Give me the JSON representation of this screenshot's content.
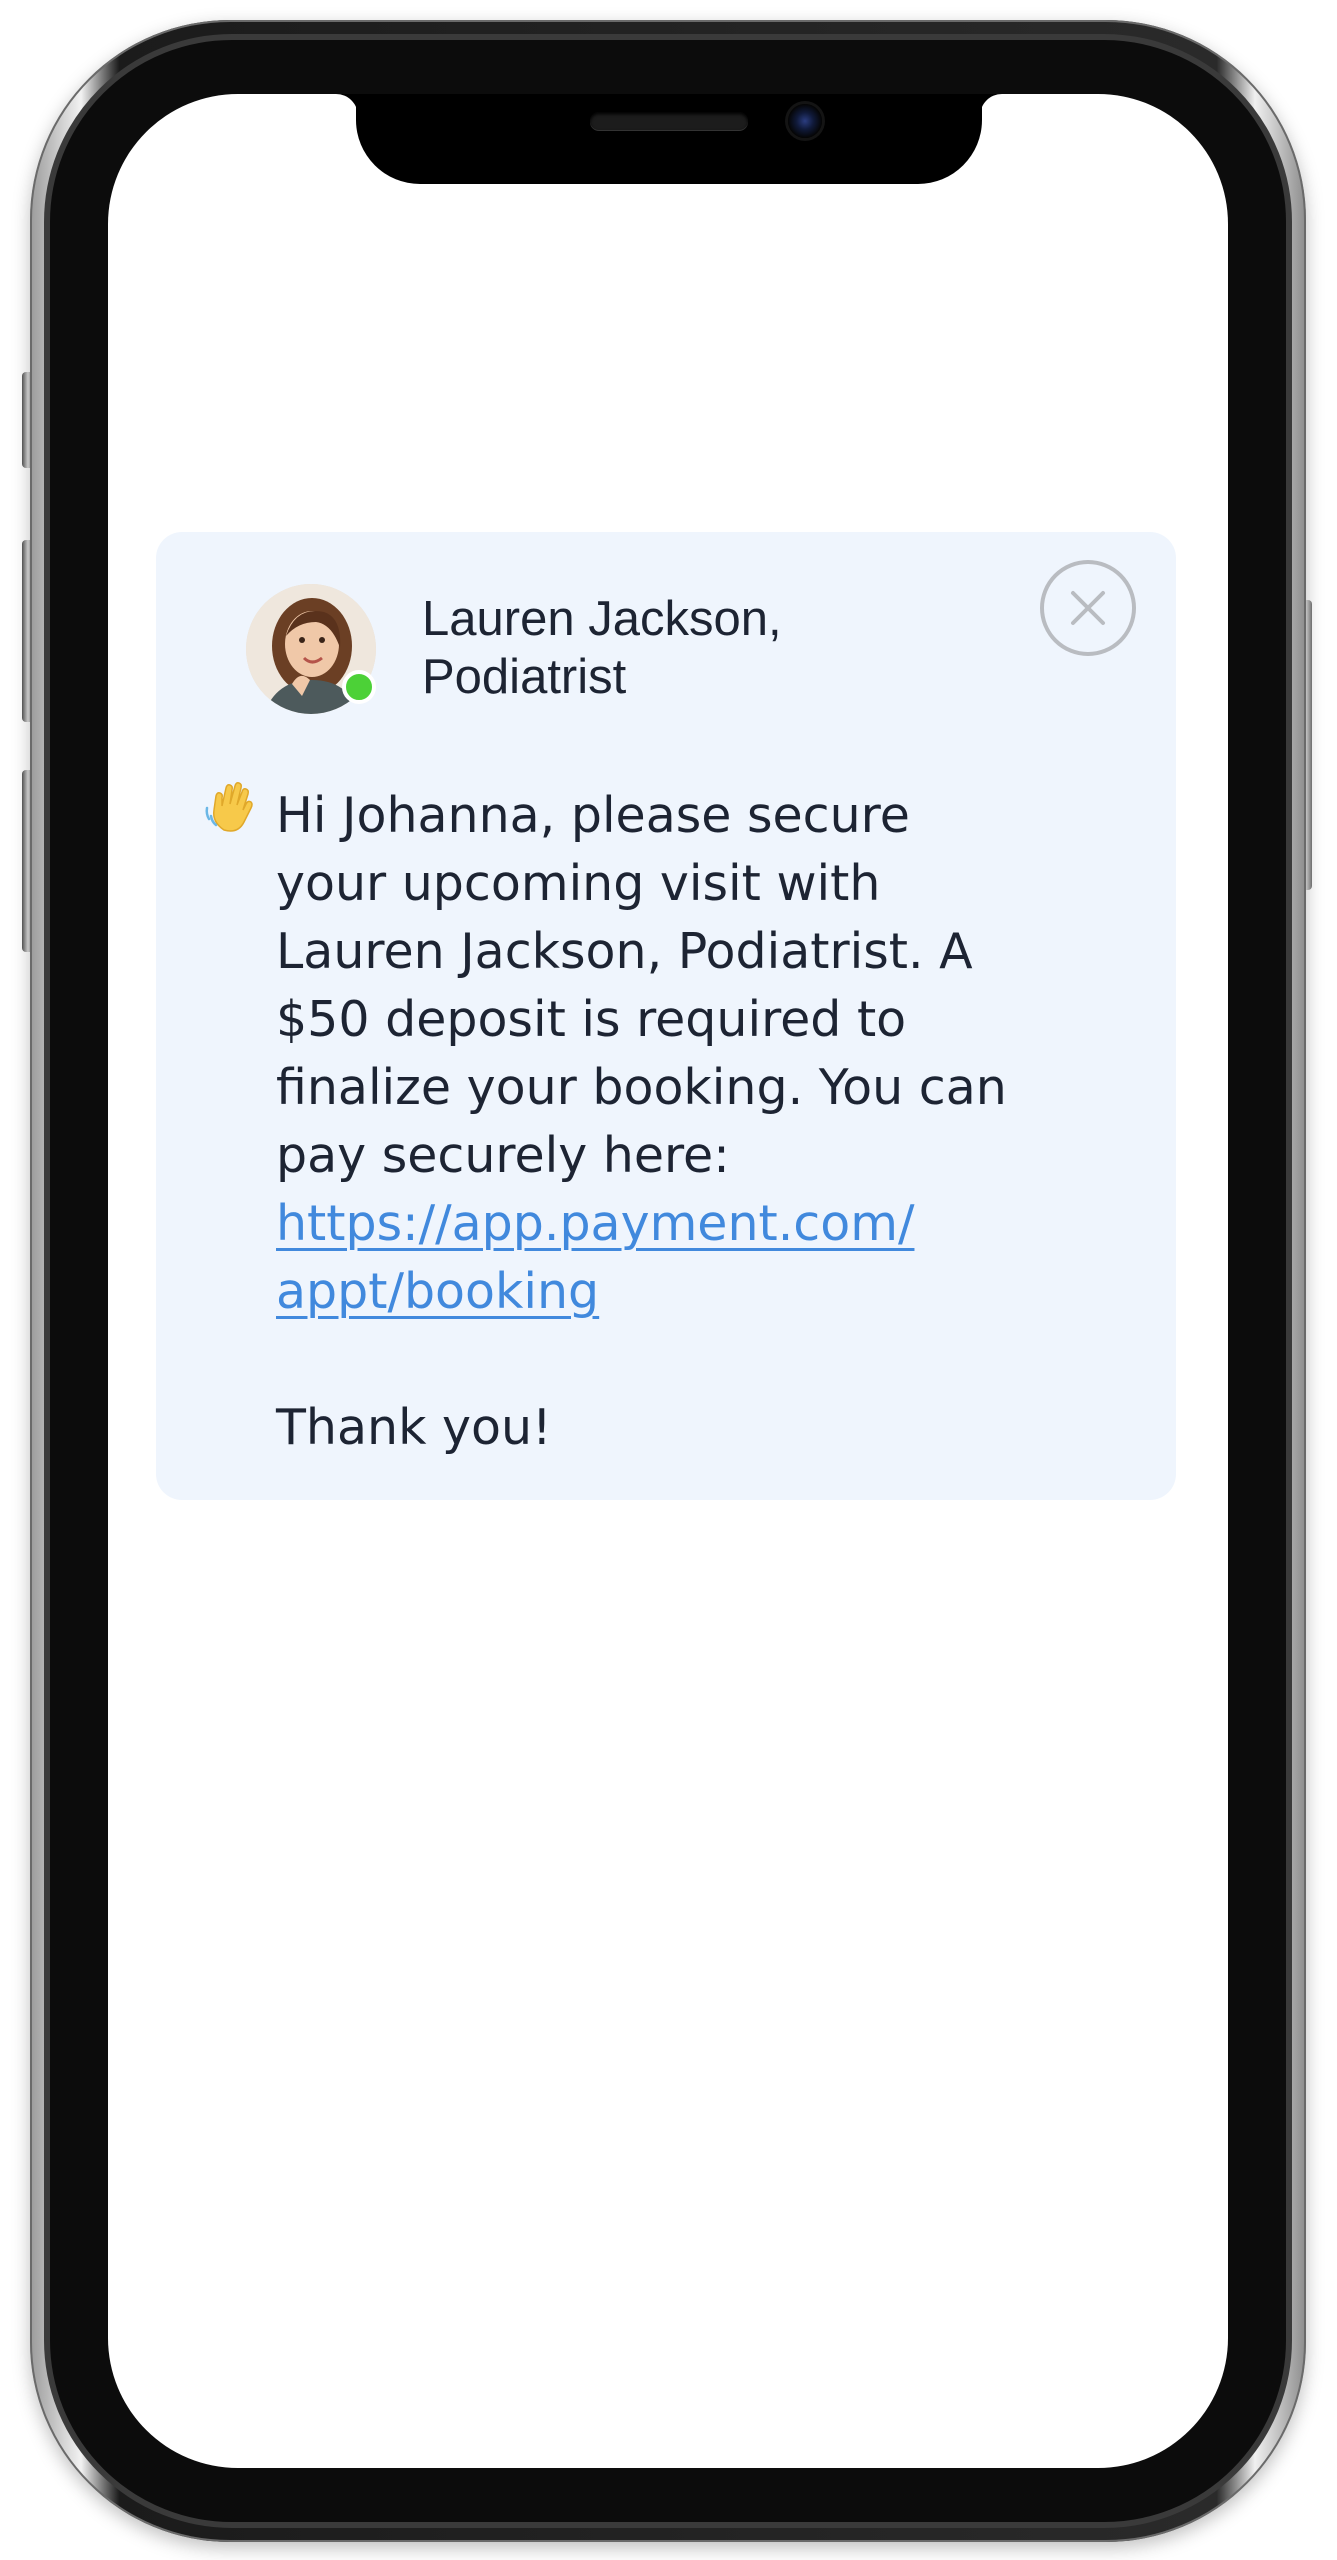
{
  "notification": {
    "sender_line1": "Lauren Jackson,",
    "sender_line2": "Podiatrist",
    "message_line1": "Hi Johanna, please secure",
    "message_line2": "your upcoming visit with",
    "message_line3": "Lauren Jackson, Podiatrist. A",
    "message_line4": "$50 deposit is required to",
    "message_line5": "finalize your booking. You can",
    "message_line6": "pay securely here:",
    "link_line1": "https://app.payment.com/",
    "link_line2": "appt/booking",
    "closing": "Thank you!"
  },
  "icons": {
    "wave": "waving-hand-icon",
    "close": "close-icon",
    "status": "online-status-icon"
  },
  "colors": {
    "card_background": "#eff5fd",
    "text": "#1d2433",
    "link": "#4189dd",
    "online": "#4cd137",
    "close_ring": "#b9bcc1"
  }
}
